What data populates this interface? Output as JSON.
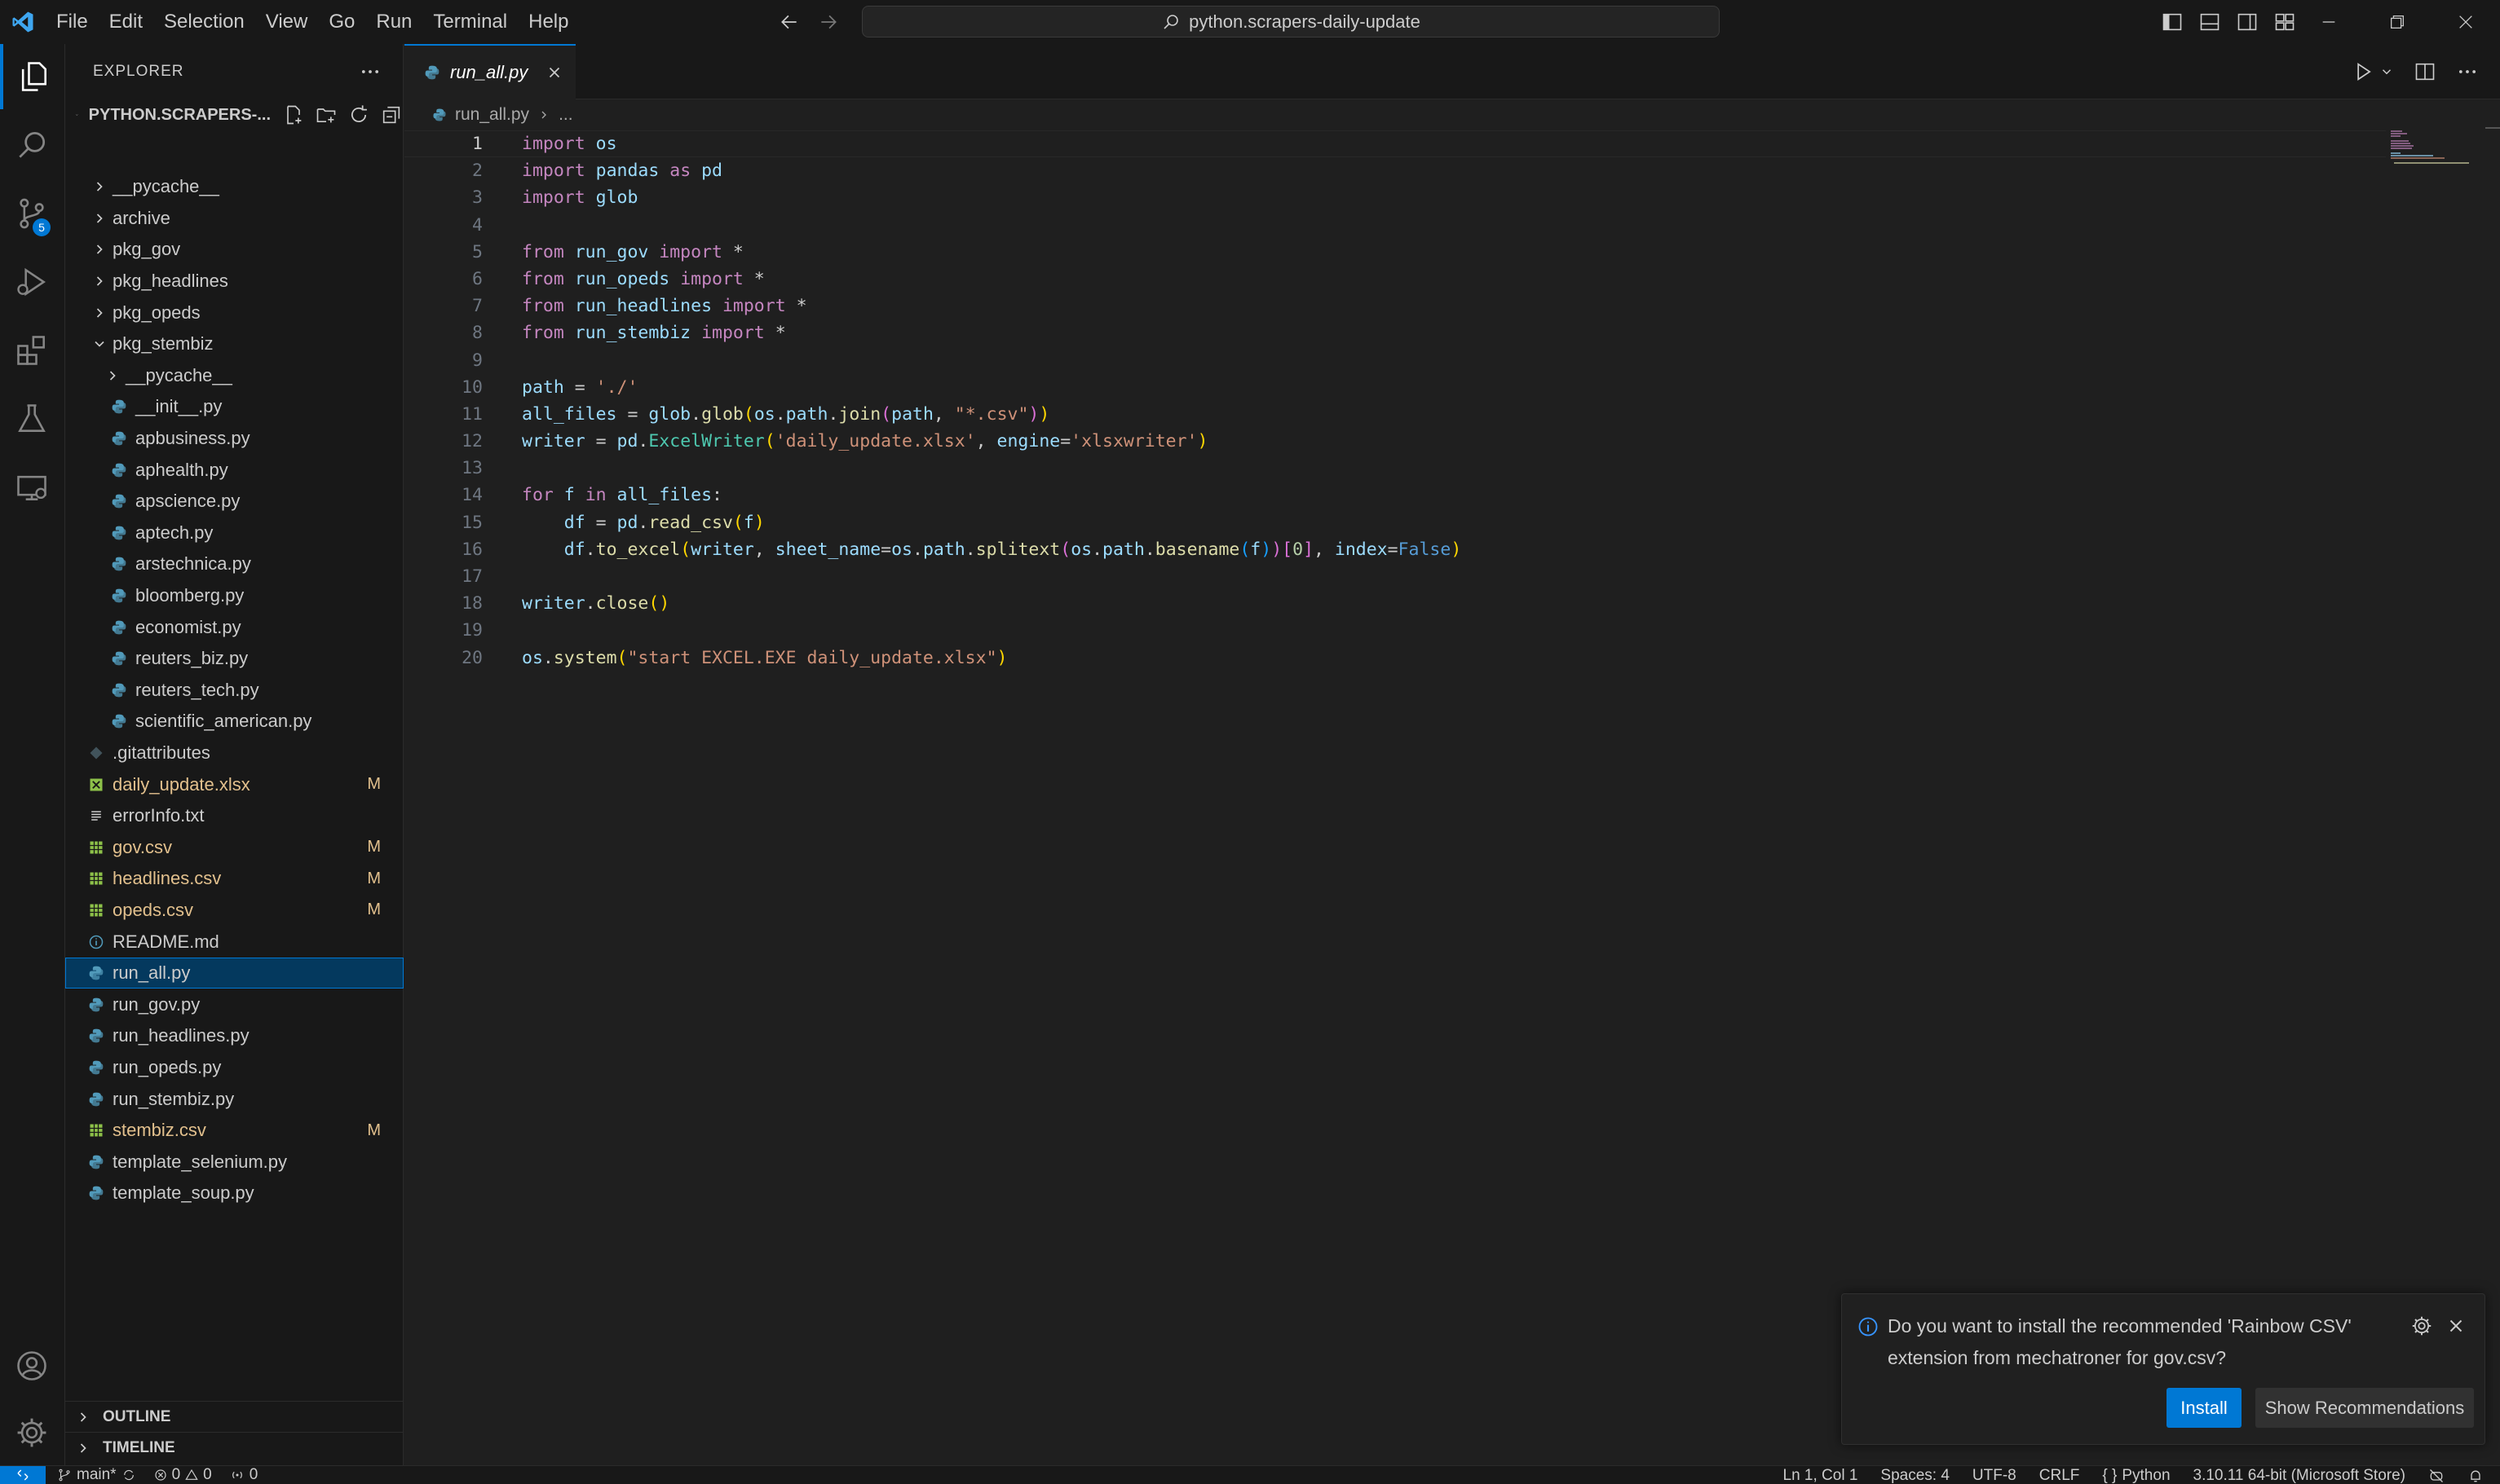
{
  "menu": [
    "File",
    "Edit",
    "Selection",
    "View",
    "Go",
    "Run",
    "Terminal",
    "Help"
  ],
  "search": {
    "text": "python.scrapers-daily-update"
  },
  "sidebar": {
    "title": "EXPLORER",
    "root_label": "PYTHON.SCRAPERS-...",
    "outline_label": "OUTLINE",
    "timeline_label": "TIMELINE"
  },
  "tree": [
    {
      "label": "__pycache__",
      "type": "folder",
      "depth": 0,
      "expanded": false
    },
    {
      "label": "archive",
      "type": "folder",
      "depth": 0,
      "expanded": false
    },
    {
      "label": "pkg_gov",
      "type": "folder",
      "depth": 0,
      "expanded": false
    },
    {
      "label": "pkg_headlines",
      "type": "folder",
      "depth": 0,
      "expanded": false
    },
    {
      "label": "pkg_opeds",
      "type": "folder",
      "depth": 0,
      "expanded": false
    },
    {
      "label": "pkg_stembiz",
      "type": "folder",
      "depth": 0,
      "expanded": true
    },
    {
      "label": "__pycache__",
      "type": "folder",
      "depth": 1,
      "expanded": false
    },
    {
      "label": "__init__.py",
      "type": "py",
      "depth": 1
    },
    {
      "label": "apbusiness.py",
      "type": "py",
      "depth": 1
    },
    {
      "label": "aphealth.py",
      "type": "py",
      "depth": 1
    },
    {
      "label": "apscience.py",
      "type": "py",
      "depth": 1
    },
    {
      "label": "aptech.py",
      "type": "py",
      "depth": 1
    },
    {
      "label": "arstechnica.py",
      "type": "py",
      "depth": 1
    },
    {
      "label": "bloomberg.py",
      "type": "py",
      "depth": 1
    },
    {
      "label": "economist.py",
      "type": "py",
      "depth": 1
    },
    {
      "label": "reuters_biz.py",
      "type": "py",
      "depth": 1
    },
    {
      "label": "reuters_tech.py",
      "type": "py",
      "depth": 1
    },
    {
      "label": "scientific_american.py",
      "type": "py",
      "depth": 1
    },
    {
      "label": ".gitattributes",
      "type": "git",
      "depth": 0
    },
    {
      "label": "daily_update.xlsx",
      "type": "xlsx",
      "depth": 0,
      "badge": "M"
    },
    {
      "label": "errorInfo.txt",
      "type": "txt",
      "depth": 0
    },
    {
      "label": "gov.csv",
      "type": "csv",
      "depth": 0,
      "badge": "M"
    },
    {
      "label": "headlines.csv",
      "type": "csv",
      "depth": 0,
      "badge": "M"
    },
    {
      "label": "opeds.csv",
      "type": "csv",
      "depth": 0,
      "badge": "M"
    },
    {
      "label": "README.md",
      "type": "md",
      "depth": 0
    },
    {
      "label": "run_all.py",
      "type": "py",
      "depth": 0,
      "selected": true
    },
    {
      "label": "run_gov.py",
      "type": "py",
      "depth": 0
    },
    {
      "label": "run_headlines.py",
      "type": "py",
      "depth": 0
    },
    {
      "label": "run_opeds.py",
      "type": "py",
      "depth": 0
    },
    {
      "label": "run_stembiz.py",
      "type": "py",
      "depth": 0
    },
    {
      "label": "stembiz.csv",
      "type": "csv",
      "depth": 0,
      "badge": "M"
    },
    {
      "label": "template_selenium.py",
      "type": "py",
      "depth": 0
    },
    {
      "label": "template_soup.py",
      "type": "py",
      "depth": 0
    }
  ],
  "activity_badge": "5",
  "tab": {
    "label": "run_all.py"
  },
  "breadcrumb": {
    "file": "run_all.py",
    "more": "..."
  },
  "code": {
    "current_line": 1,
    "lines": [
      "import os",
      "import pandas as pd",
      "import glob",
      "",
      "from run_gov import *",
      "from run_opeds import *",
      "from run_headlines import *",
      "from run_stembiz import *",
      "",
      "path = './'",
      "all_files = glob.glob(os.path.join(path, \"*.csv\"))",
      "writer = pd.ExcelWriter('daily_update.xlsx', engine='xlsxwriter')",
      "",
      "for f in all_files:",
      "    df = pd.read_csv(f)",
      "    df.to_excel(writer, sheet_name=os.path.splitext(os.path.basename(f))[0], index=False)",
      "",
      "writer.close()",
      "",
      "os.system(\"start EXCEL.EXE daily_update.xlsx\")"
    ]
  },
  "notification": {
    "message": "Do you want to install the recommended 'Rainbow CSV' extension from mechatroner for gov.csv?",
    "install_label": "Install",
    "show_label": "Show Recommendations"
  },
  "status": {
    "branch": "main*",
    "errors": "0",
    "warnings": "0",
    "ports": "0",
    "position": "Ln 1, Col 1",
    "spaces": "Spaces: 4",
    "encoding": "UTF-8",
    "eol": "CRLF",
    "language": "Python",
    "interpreter": "3.10.11 64-bit (Microsoft Store)"
  },
  "colors": {
    "accent": "#0078d4",
    "modified": "#e2c08d",
    "selection": "#04395e"
  }
}
